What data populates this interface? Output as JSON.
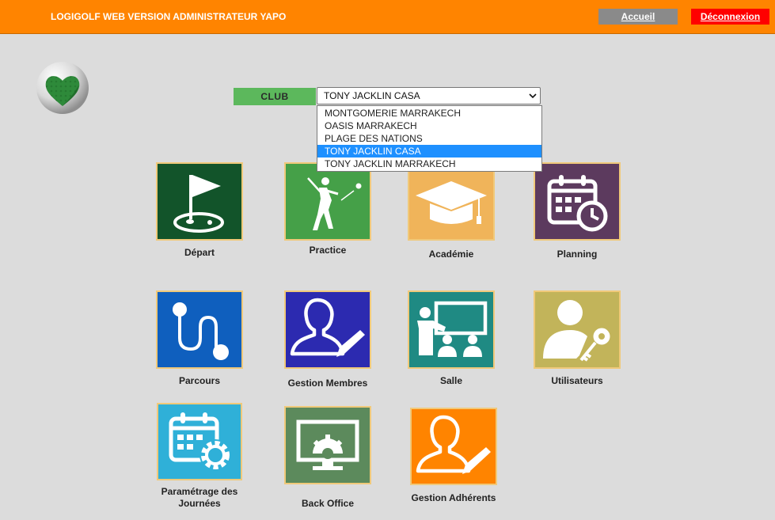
{
  "header": {
    "title": "LOGIGOLF WEB VERSION ADMINISTRATEUR YAPO",
    "home_label": "Accueil",
    "logout_label": "Déconnexion"
  },
  "club": {
    "label": "CLUB",
    "selected": "TONY JACKLIN CASA",
    "options": [
      "MONTGOMERIE MARRAKECH",
      "OASIS MARRAKECH",
      "PLAGE DES NATIONS",
      "TONY JACKLIN CASA",
      "TONY JACKLIN MARRAKECH"
    ]
  },
  "tiles": [
    {
      "label": "Départ",
      "icon": "golf-flag-icon",
      "color": "#12542a"
    },
    {
      "label": "Practice",
      "icon": "golfer-icon",
      "color": "#45a048"
    },
    {
      "label": "Académie",
      "icon": "graduation-cap-icon",
      "color": "#f0b45a"
    },
    {
      "label": "Planning",
      "icon": "calendar-clock-icon",
      "color": "#5c3a5e"
    },
    {
      "label": "Parcours",
      "icon": "route-icon",
      "color": "#0f5fbe"
    },
    {
      "label": "Gestion Membres",
      "icon": "user-edit-icon",
      "color": "#2c2ab0"
    },
    {
      "label": "Salle",
      "icon": "classroom-icon",
      "color": "#1f8a83"
    },
    {
      "label": "Utilisateurs",
      "icon": "user-key-icon",
      "color": "#c2b45a"
    },
    {
      "label": "Paramétrage des Journées",
      "icon": "calendar-gear-icon",
      "color": "#2fb0d8"
    },
    {
      "label": "Back Office",
      "icon": "monitor-gear-icon",
      "color": "#5c8a5c"
    },
    {
      "label": "Gestion Adhérents",
      "icon": "user-edit-icon",
      "color": "#ff8400"
    }
  ]
}
